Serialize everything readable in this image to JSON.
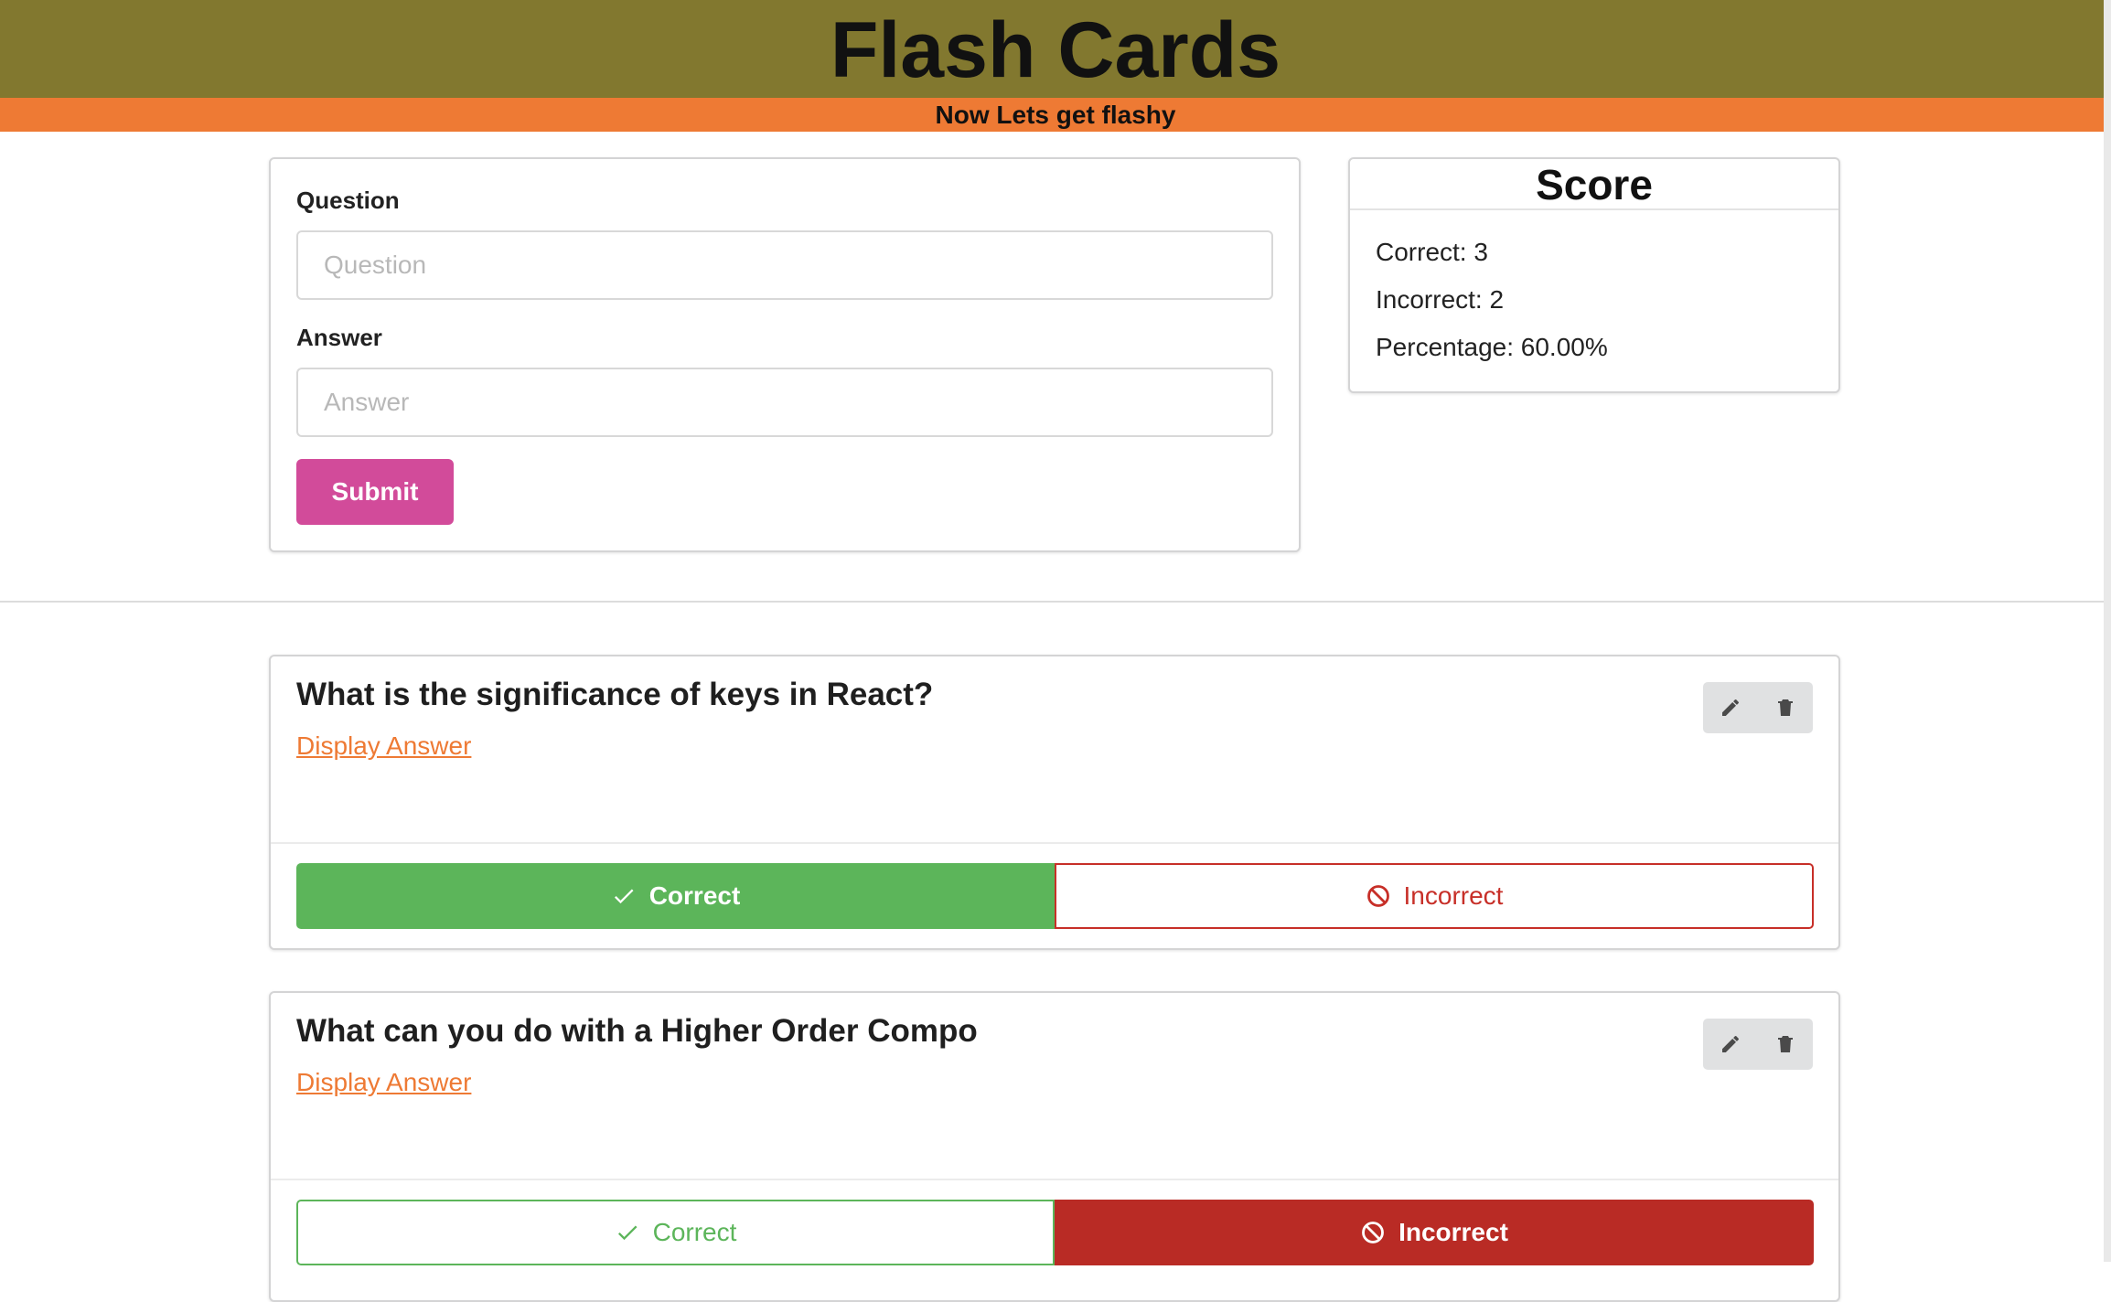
{
  "header": {
    "title": "Flash Cards",
    "subtitle": "Now Lets get flashy"
  },
  "form": {
    "question_label": "Question",
    "question_placeholder": "Question",
    "question_value": "",
    "answer_label": "Answer",
    "answer_placeholder": "Answer",
    "answer_value": "",
    "submit_label": "Submit"
  },
  "score": {
    "title": "Score",
    "correct": "Correct: 3",
    "incorrect": "Incorrect: 2",
    "percentage": "Percentage: 60.00%"
  },
  "cards": [
    {
      "question": "What is the significance of keys in React?",
      "display_answer_label": "Display Answer",
      "correct_label": "Correct",
      "incorrect_label": "Incorrect",
      "selected": "correct"
    },
    {
      "question": "What can you do with a Higher Order Compo",
      "display_answer_label": "Display Answer",
      "correct_label": "Correct",
      "incorrect_label": "Incorrect",
      "selected": "incorrect"
    }
  ],
  "icons": {
    "edit": "pencil-icon",
    "delete": "trash-icon",
    "correct": "check-icon",
    "incorrect": "ban-icon"
  },
  "colors": {
    "header_bg": "#82782f",
    "subtitle_bg": "#ee7a34",
    "submit_bg": "#d24b9a",
    "link": "#ee7a34",
    "correct": "#5cb55a",
    "incorrect": "#b92b25"
  }
}
